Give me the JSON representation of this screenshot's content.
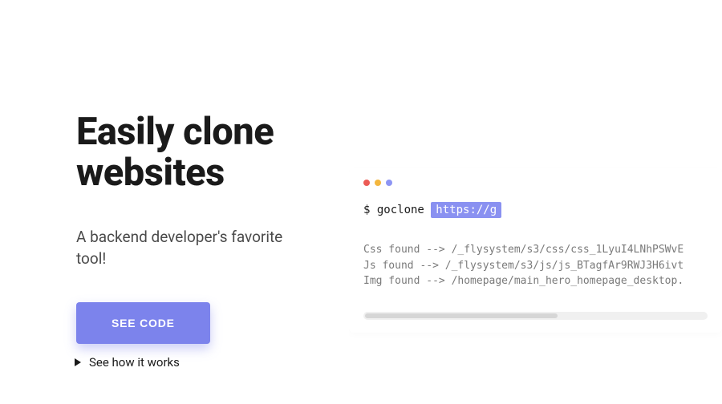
{
  "hero": {
    "title_line1": "Easily clone",
    "title_line2": "websites",
    "subtitle": "A backend developer's favorite tool!",
    "cta_label": "SEE CODE",
    "secondary_label": "See how it works"
  },
  "terminal": {
    "prompt": "$ goclone",
    "url_text": "https://g",
    "output": [
      "Css found --> /_flysystem/s3/css/css_1LyuI4LNhPSWvE",
      "Js found --> /_flysystem/s3/js/js_BTagfAr9RWJ3H6ivt",
      "Img found --> /homepage/main_hero_homepage_desktop."
    ]
  }
}
